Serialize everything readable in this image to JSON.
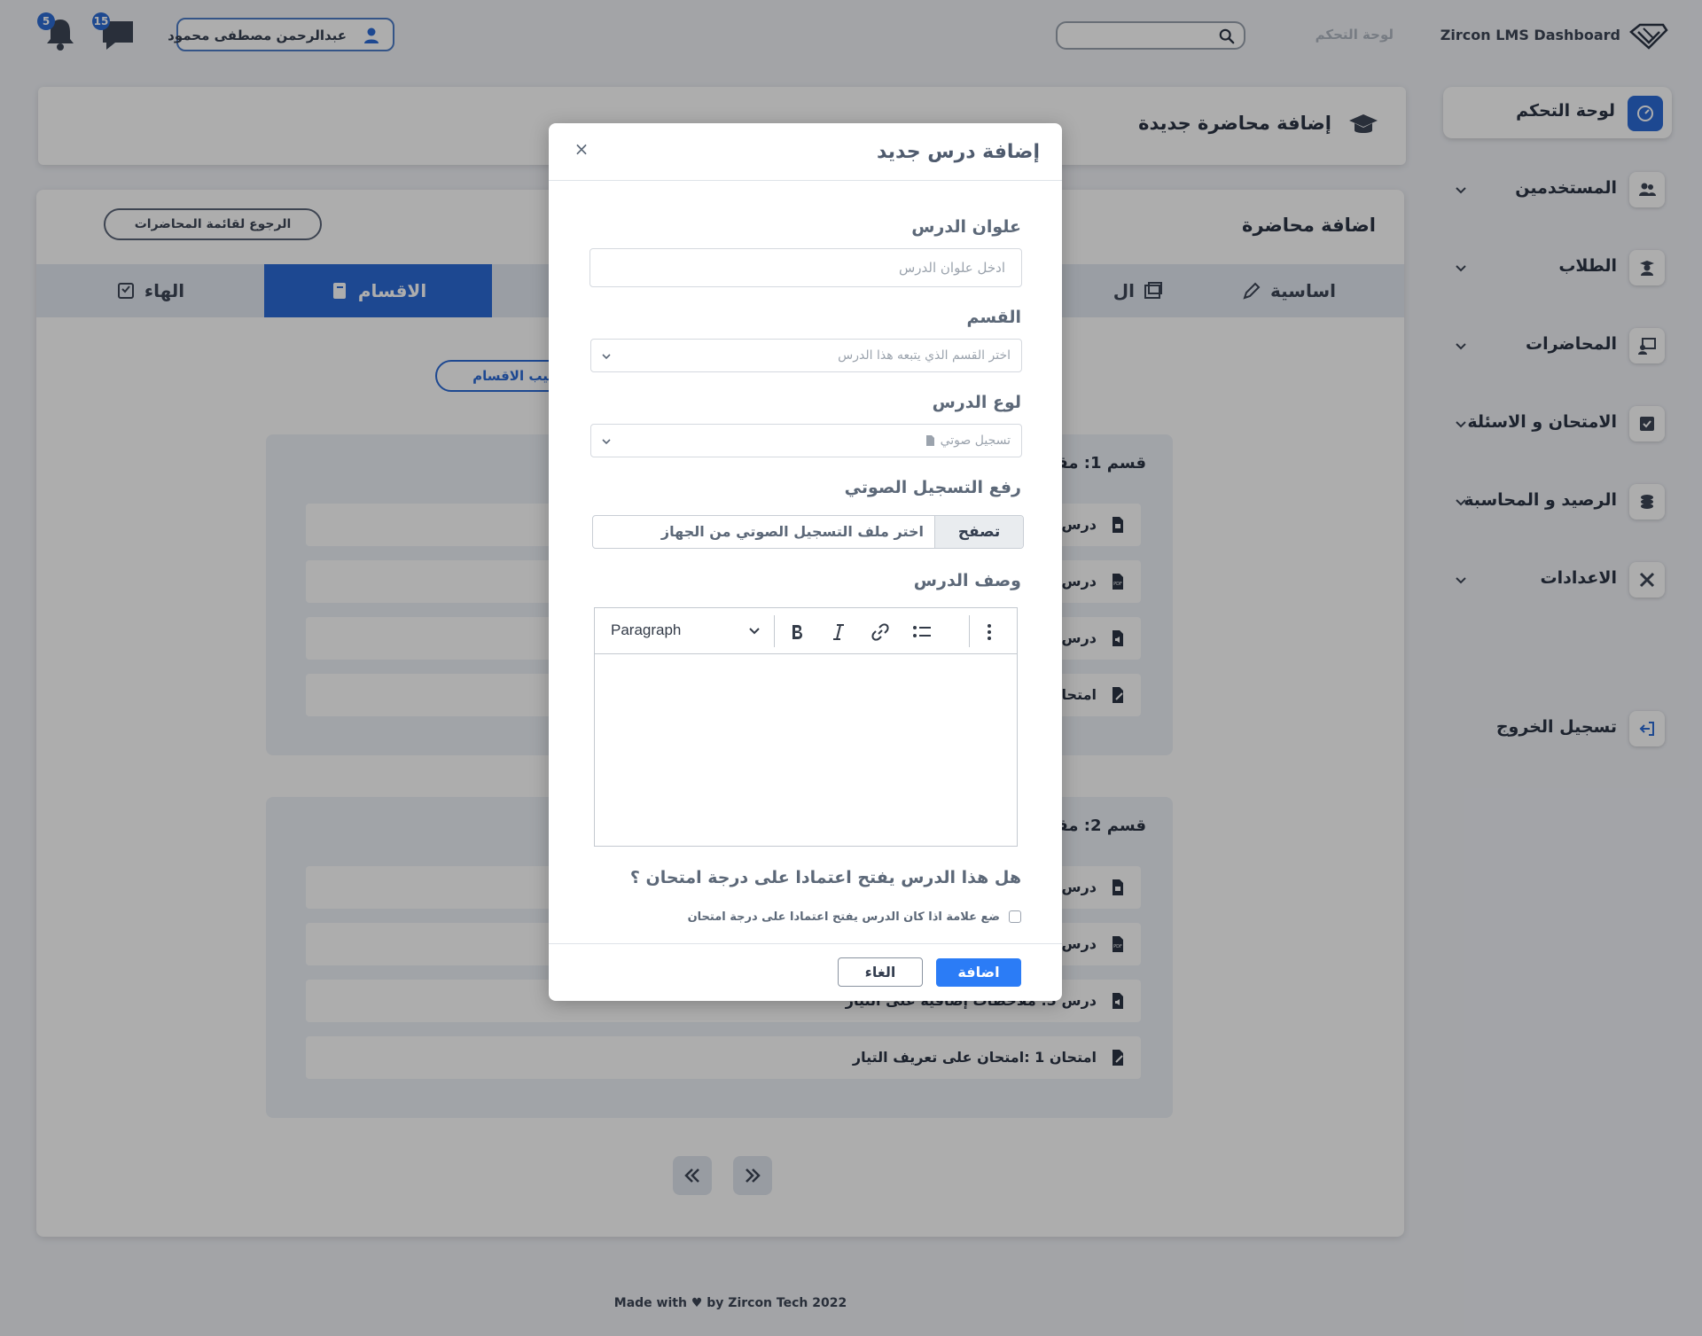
{
  "topbar": {
    "brand_name": "Zircon LMS Dashboard",
    "breadcrumb": "لوحة التحكم",
    "search_placeholder": "",
    "user_name": "عبدالرحمن مصطفى محمود",
    "messages_count": "15",
    "notifications_count": "5"
  },
  "sidebar": {
    "items": [
      {
        "label": "لوحة التحكم",
        "icon": "dashboard-icon"
      },
      {
        "label": "المستخدمين",
        "icon": "users-icon"
      },
      {
        "label": "الطلاب",
        "icon": "students-icon"
      },
      {
        "label": "المحاضرات",
        "icon": "lectures-icon"
      },
      {
        "label": "الامتحان و الاسئلة",
        "icon": "exam-icon"
      },
      {
        "label": "الرصيد و المحاسبة",
        "icon": "coins-icon"
      },
      {
        "label": "الاعدادات",
        "icon": "tools-icon"
      }
    ],
    "logout": "تسجيل الخروج"
  },
  "page": {
    "title": "إضافة محاضرة جديدة",
    "card_title": "اضافة محاضرة",
    "back_button": "الرجوع لقائمة المحاضرات",
    "tabs": [
      "اساسية",
      "ال",
      "الاقسام",
      "الهاء"
    ],
    "active_tab": "الاقسام",
    "sort_button": "ترتيب الاقسام",
    "sections": [
      {
        "title": "قسم 1: مقد",
        "lessons": [
          "درس",
          "درس",
          "درس",
          "امتحا"
        ]
      },
      {
        "title": "قسم 2: مقد",
        "lessons": [
          "درس",
          "درس",
          "درس 3: ملاحظات إضافية على التيار",
          "امتحان 1 :امتحان على تعريف التيار"
        ]
      }
    ]
  },
  "footer": {
    "made_with": "Made with",
    "by": "by Zircon Tech 2022"
  },
  "modal": {
    "title": "إضافة درس جديد",
    "close": "×",
    "title_label": "علوان الدرس",
    "title_placeholder": "ادخل علوان الدرس",
    "section_label": "القسم",
    "section_placeholder": "اختر القسم الذي يتبعه هذا الدرس",
    "type_label": "لوع الدرس",
    "type_value": "تسجيل صوتي",
    "upload_label": "رفع التسجيل الصوتي",
    "browse_button": "تصفح",
    "file_placeholder": "اختر ملف التسجيل الصوتي من الجهاز",
    "description_label": "وصف الدرس",
    "editor": {
      "paragraph": "Paragraph"
    },
    "question": "هل هذا الدرس يفتح اعتمادا على درجة امتحان ؟",
    "checkbox_label": "ضع علامة اذا كان الدرس يفتح اعتمادا على درجة امتحان",
    "add_button": "اضافة",
    "cancel_button": "الغاء"
  },
  "colors": {
    "primary": "#2b6ad6",
    "add_button": "#2b7cf6",
    "text_dark": "#2b3445"
  }
}
